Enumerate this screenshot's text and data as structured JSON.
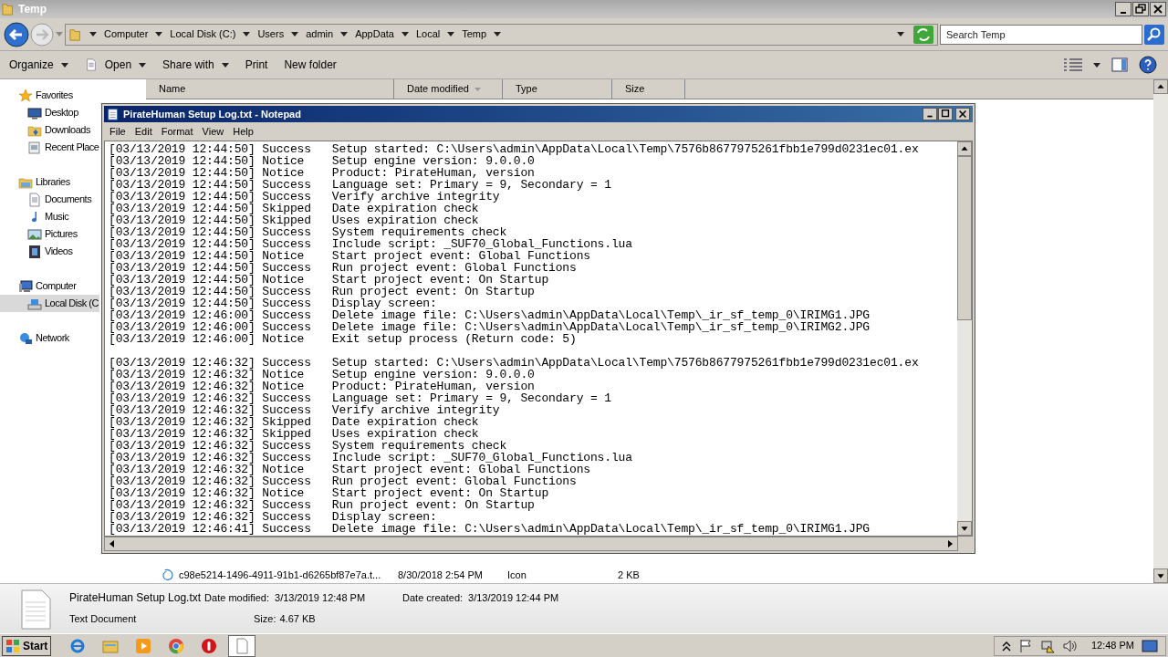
{
  "explorer": {
    "title": "Temp",
    "breadcrumb": [
      "Computer",
      "Local Disk (C:)",
      "Users",
      "admin",
      "AppData",
      "Local",
      "Temp"
    ],
    "search": {
      "placeholder": "Search Temp"
    },
    "toolbar": [
      {
        "label": "Organize",
        "dropdown": true
      },
      {
        "label": "Open",
        "dropdown": true
      },
      {
        "label": "Share with",
        "dropdown": true
      },
      {
        "label": "Print",
        "dropdown": false
      },
      {
        "label": "New folder",
        "dropdown": false
      }
    ],
    "sidebar": [
      {
        "label": "Favorites",
        "selected": false,
        "children": [
          {
            "label": "Desktop",
            "selected": false
          },
          {
            "label": "Downloads",
            "selected": false
          },
          {
            "label": "Recent Place",
            "selected": false
          }
        ]
      },
      {
        "label": "Libraries",
        "selected": false,
        "children": [
          {
            "label": "Documents",
            "selected": false
          },
          {
            "label": "Music",
            "selected": false
          },
          {
            "label": "Pictures",
            "selected": false
          },
          {
            "label": "Videos",
            "selected": false
          }
        ]
      },
      {
        "label": "Computer",
        "selected": false,
        "children": [
          {
            "label": "Local Disk (C",
            "selected": true
          }
        ]
      },
      {
        "label": "Network",
        "selected": false
      }
    ],
    "columns": [
      {
        "label": "Name",
        "sorted": false
      },
      {
        "label": "Date modified",
        "sorted": true
      },
      {
        "label": "Type",
        "sorted": false
      },
      {
        "label": "Size",
        "sorted": false
      }
    ],
    "rows": [
      {
        "name": "c98e5214-1496-4911-91b1-d6265bf87e7a.t...",
        "date_modified": "8/30/2018 2:54 PM",
        "type": "Icon",
        "size": "2 KB"
      }
    ],
    "details": {
      "name": "PirateHuman Setup Log.txt",
      "kind": "Text Document",
      "date_modified_label": "Date modified:",
      "date_modified": "3/13/2019 12:48 PM",
      "date_created_label": "Date created:",
      "date_created": "3/13/2019 12:44 PM",
      "size_label": "Size:",
      "size": "4.67 KB"
    }
  },
  "notepad": {
    "title": "PirateHuman Setup Log.txt - Notepad",
    "menu": [
      "File",
      "Edit",
      "Format",
      "View",
      "Help"
    ],
    "log_blocks": [
      {
        "lines": [
          "[03/13/2019 12:44:50] Success   Setup started: C:\\Users\\admin\\AppData\\Local\\Temp\\7576b8677975261fbb1e799d0231ec01.ex",
          "[03/13/2019 12:44:50] Notice    Setup engine version: 9.0.0.0",
          "[03/13/2019 12:44:50] Notice    Product: PirateHuman, version",
          "[03/13/2019 12:44:50] Success   Language set: Primary = 9, Secondary = 1",
          "[03/13/2019 12:44:50] Success   Verify archive integrity",
          "[03/13/2019 12:44:50] Skipped   Date expiration check",
          "[03/13/2019 12:44:50] Skipped   Uses expiration check",
          "[03/13/2019 12:44:50] Success   System requirements check",
          "[03/13/2019 12:44:50] Success   Include script: _SUF70_Global_Functions.lua",
          "[03/13/2019 12:44:50] Notice    Start project event: Global Functions",
          "[03/13/2019 12:44:50] Success   Run project event: Global Functions",
          "[03/13/2019 12:44:50] Notice    Start project event: On Startup",
          "[03/13/2019 12:44:50] Success   Run project event: On Startup",
          "[03/13/2019 12:44:50] Success   Display screen:",
          "[03/13/2019 12:46:00] Success   Delete image file: C:\\Users\\admin\\AppData\\Local\\Temp\\_ir_sf_temp_0\\IRIMG1.JPG",
          "[03/13/2019 12:46:00] Success   Delete image file: C:\\Users\\admin\\AppData\\Local\\Temp\\_ir_sf_temp_0\\IRIMG2.JPG",
          "[03/13/2019 12:46:00] Notice    Exit setup process (Return code: 5)"
        ]
      },
      {
        "lines": [
          "[03/13/2019 12:46:32] Success   Setup started: C:\\Users\\admin\\AppData\\Local\\Temp\\7576b8677975261fbb1e799d0231ec01.ex",
          "[03/13/2019 12:46:32] Notice    Setup engine version: 9.0.0.0",
          "[03/13/2019 12:46:32] Notice    Product: PirateHuman, version",
          "[03/13/2019 12:46:32] Success   Language set: Primary = 9, Secondary = 1",
          "[03/13/2019 12:46:32] Success   Verify archive integrity",
          "[03/13/2019 12:46:32] Skipped   Date expiration check",
          "[03/13/2019 12:46:32] Skipped   Uses expiration check",
          "[03/13/2019 12:46:32] Success   System requirements check",
          "[03/13/2019 12:46:32] Success   Include script: _SUF70_Global_Functions.lua",
          "[03/13/2019 12:46:32] Notice    Start project event: Global Functions",
          "[03/13/2019 12:46:32] Success   Run project event: Global Functions",
          "[03/13/2019 12:46:32] Notice    Start project event: On Startup",
          "[03/13/2019 12:46:32] Success   Run project event: On Startup",
          "[03/13/2019 12:46:32] Success   Display screen:",
          "[03/13/2019 12:46:41] Success   Delete image file: C:\\Users\\admin\\AppData\\Local\\Temp\\_ir_sf_temp_0\\IRIMG1.JPG"
        ]
      }
    ]
  },
  "taskbar": {
    "start": "Start",
    "apps": [
      {
        "active": false
      },
      {
        "active": false
      },
      {
        "active": false
      },
      {
        "active": false
      },
      {
        "active": false
      },
      {
        "active": true
      }
    ],
    "clock": "12:48 PM"
  }
}
